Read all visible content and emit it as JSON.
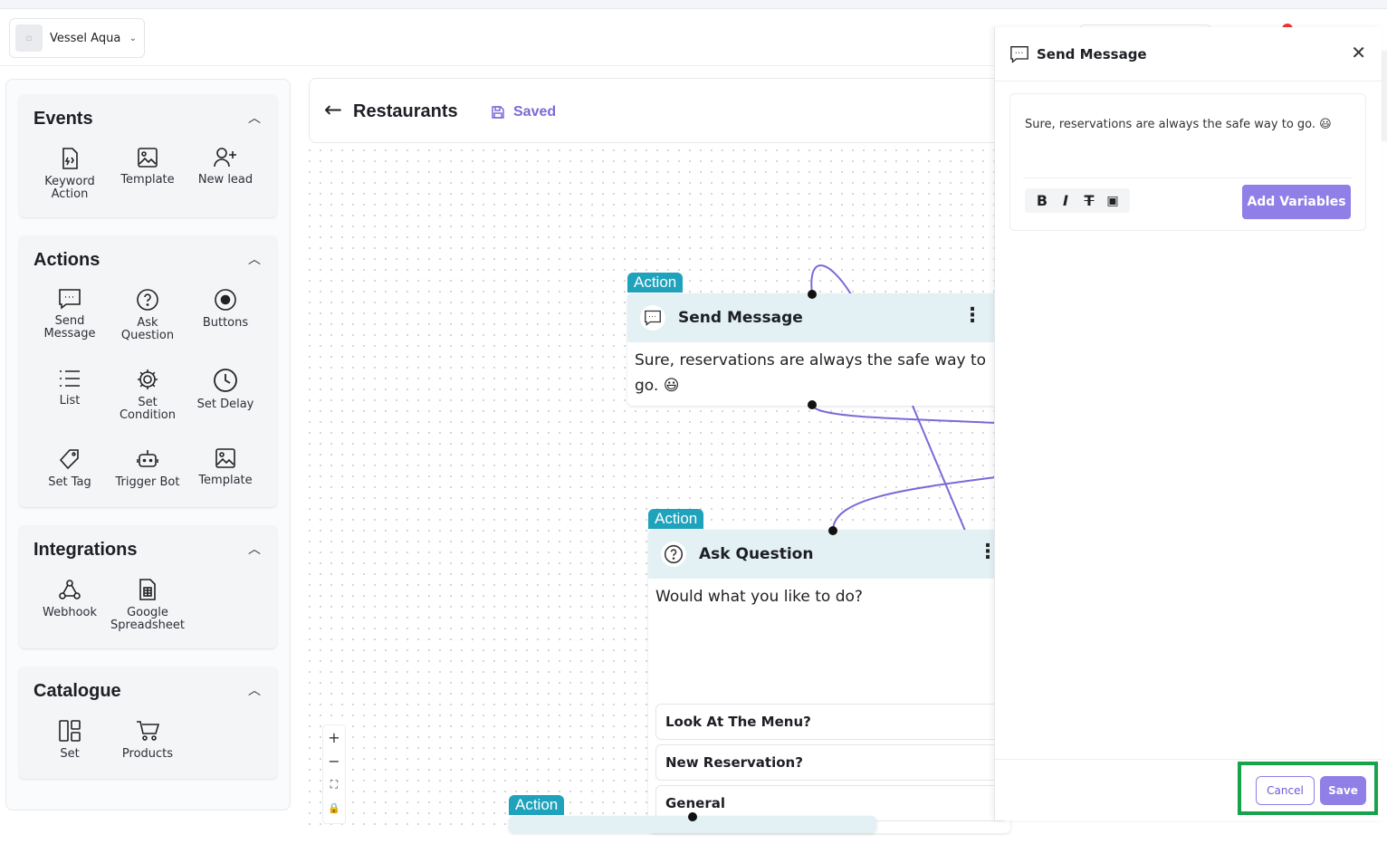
{
  "workspace": {
    "name": "Vessel Aqua"
  },
  "sidebar": {
    "sections": [
      {
        "title": "Events",
        "items": [
          {
            "label": "Keyword Action",
            "icon": "keyword-icon"
          },
          {
            "label": "Template",
            "icon": "image-icon"
          },
          {
            "label": "New lead",
            "icon": "user-plus-icon"
          }
        ]
      },
      {
        "title": "Actions",
        "items": [
          {
            "label": "Send Message",
            "icon": "message-icon"
          },
          {
            "label": "Ask Question",
            "icon": "question-icon"
          },
          {
            "label": "Buttons",
            "icon": "record-icon"
          },
          {
            "label": "List",
            "icon": "list-icon"
          },
          {
            "label": "Set Condition",
            "icon": "gear-icon"
          },
          {
            "label": "Set Delay",
            "icon": "clock-icon"
          },
          {
            "label": "Set Tag",
            "icon": "tag-icon"
          },
          {
            "label": "Trigger Bot",
            "icon": "bot-icon"
          },
          {
            "label": "Template",
            "icon": "image-icon"
          }
        ]
      },
      {
        "title": "Integrations",
        "items": [
          {
            "label": "Webhook",
            "icon": "webhook-icon"
          },
          {
            "label": "Google Spreadsheet",
            "icon": "spreadsheet-icon"
          }
        ]
      },
      {
        "title": "Catalogue",
        "items": [
          {
            "label": "Set",
            "icon": "grid-icon"
          },
          {
            "label": "Products",
            "icon": "cart-icon"
          }
        ]
      }
    ]
  },
  "flow": {
    "title": "Restaurants",
    "status": "Saved"
  },
  "nodes": {
    "send_message": {
      "tag": "Action",
      "title": "Send Message",
      "body": "Sure, reservations are always the safe way to go. 😃"
    },
    "ask_question": {
      "tag": "Action",
      "title": "Ask Question",
      "body": "Would what you like to do?",
      "choices": [
        "Look At The Menu?",
        "New Reservation?",
        "General"
      ]
    },
    "third": {
      "tag": "Action"
    }
  },
  "zoom": {
    "in": "+",
    "out": "−",
    "fit": "⛶",
    "lock": "🔒"
  },
  "panel": {
    "title": "Send Message",
    "close": "✕",
    "message": "Sure, reservations are always the safe way to go. 😃",
    "format": {
      "bold": "B",
      "italic": "I",
      "strike": "T",
      "image": "▣"
    },
    "add_variables": "Add Variables",
    "cancel": "Cancel",
    "save": "Save"
  },
  "colors": {
    "accent": "#8f7fe6",
    "action_tag": "#1fa2bb",
    "node_header": "#e3f1f5",
    "highlight": "#16a34a",
    "edge": "#7a6ad8"
  }
}
